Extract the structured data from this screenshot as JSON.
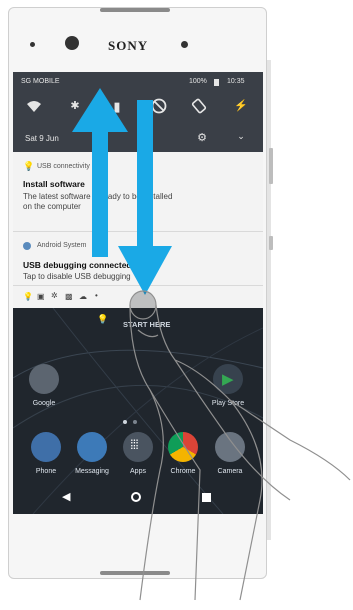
{
  "device": {
    "brand": "SONY"
  },
  "status_bar": {
    "carrier": "SG MOBILE",
    "battery": "100%",
    "time": "10:35"
  },
  "quick_settings": {
    "date": "Sat 9 Jun",
    "icons": [
      "wifi-icon",
      "bluetooth-icon",
      "do-not-disturb-icon",
      "auto-rotate-icon",
      "flashlight-icon"
    ]
  },
  "notifications": [
    {
      "app": "USB connectivity",
      "title": "Install software",
      "body": [
        "The latest software is ready to be installed",
        "on the computer"
      ]
    },
    {
      "app": "Android System",
      "title": "USB debugging connected",
      "body": [
        "Tap to disable USB debugging"
      ]
    }
  ],
  "home": {
    "apps": [
      {
        "label": "Google"
      },
      {
        "label": "Play Store"
      }
    ],
    "dock": [
      {
        "label": "Phone"
      },
      {
        "label": "Messaging"
      },
      {
        "label": "Apps"
      },
      {
        "label": "Chrome"
      },
      {
        "label": "Camera"
      }
    ],
    "banner": "START HERE"
  },
  "colors": {
    "arrow": "#1aa9e6",
    "status_bg": "#3a3f47",
    "notif_bg": "#f3f3f3"
  }
}
